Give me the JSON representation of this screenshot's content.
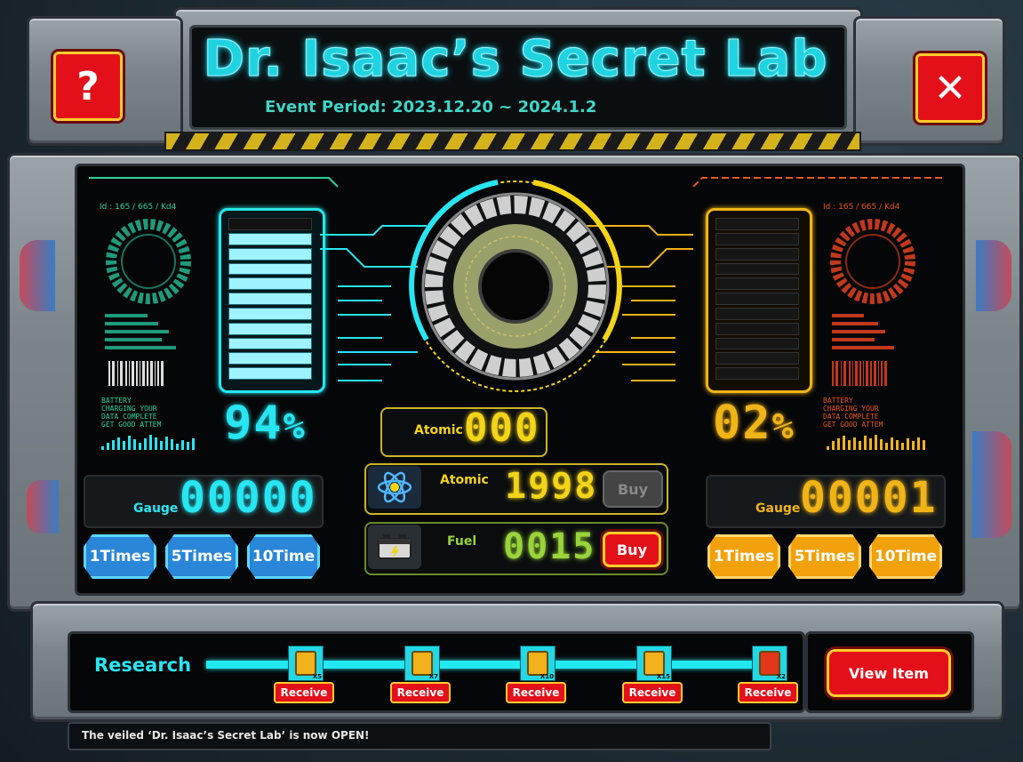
{
  "header": {
    "title": "Dr. Isaac’s Secret Lab",
    "event_period": "Event Period: 2023.12.20 ~ 2024.1.2",
    "help_icon": "?",
    "close_icon": "✕"
  },
  "left": {
    "micro_label": "Id : 165 / 665 / Kd4",
    "battery_text_1": "BATTERY",
    "battery_text_2": "CHARGING YOUR",
    "battery_text_3": "DATA COMPLETE",
    "battery_text_4": "GET GOOD ATTEM",
    "percent": "94",
    "percent_sign": "%",
    "gauge_label": "Gauge",
    "gauge_value": "00000",
    "buttons": [
      "1Times",
      "5Times",
      "10Time"
    ],
    "level": 0.94,
    "color": "#27e6f2"
  },
  "right": {
    "micro_label": "Id : 165 / 665 / Kd4",
    "battery_text_1": "BATTERY",
    "battery_text_2": "CHARGING YOUR",
    "battery_text_3": "DATA COMPLETE",
    "battery_text_4": "GET GOOD ATTEM",
    "percent": "02",
    "percent_sign": "%",
    "gauge_label": "Gauge",
    "gauge_value": "00001",
    "buttons": [
      "1Times",
      "5Times",
      "10Time"
    ],
    "level": 0.02,
    "color": "#f0b417"
  },
  "center": {
    "atomic_label": "Atomic",
    "atomic_value": "000",
    "atomic_item_label": "Atomic",
    "atomic_item_value": "1998",
    "atomic_buy": "Buy",
    "fuel_label": "Fuel",
    "fuel_value": "0015",
    "fuel_buy": "Buy",
    "atom_icon": "atom-icon",
    "battery_icon": "battery-icon"
  },
  "research": {
    "label": "Research",
    "rewards": [
      {
        "qty": "X5",
        "receive": "Receive",
        "color": "yellow"
      },
      {
        "qty": "X7",
        "receive": "Receive",
        "color": "yellow"
      },
      {
        "qty": "X10",
        "receive": "Receive",
        "color": "yellow"
      },
      {
        "qty": "X15",
        "receive": "Receive",
        "color": "yellow"
      },
      {
        "qty": "X2",
        "receive": "Receive",
        "color": "red"
      }
    ],
    "view_item": "View Item"
  },
  "ticker": "The veiled ‘Dr. Isaac’s Secret Lab’ is now OPEN!"
}
